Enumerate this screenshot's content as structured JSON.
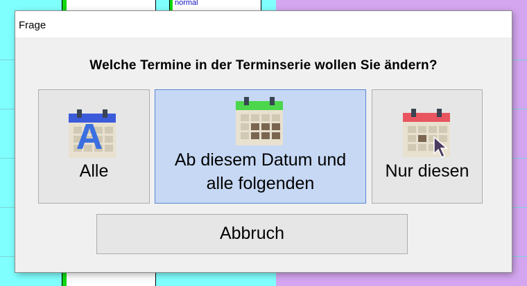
{
  "background": {
    "appointment_text": "normal"
  },
  "dialog": {
    "title": "Frage",
    "question": "Welche Termine in der Terminserie wollen Sie ändern?",
    "options": [
      {
        "label": "Alle",
        "icon": "calendar-all-icon",
        "accent": "#3b5bdb",
        "selected": false
      },
      {
        "label_line1": "Ab diesem Datum und",
        "label_line2": "alle folgenden",
        "icon": "calendar-following-icon",
        "accent": "#4cd64c",
        "selected": true
      },
      {
        "label": "Nur diesen",
        "icon": "calendar-single-icon",
        "accent": "#e8555f",
        "selected": false
      }
    ],
    "cancel_label": "Abbruch"
  },
  "colors": {
    "selected_bg": "#c6d8f4",
    "selected_border": "#5b87d1",
    "dialog_bg": "#f0f0f0",
    "bg_cyan": "#80ffff",
    "bg_purple": "#d4a6f0"
  }
}
